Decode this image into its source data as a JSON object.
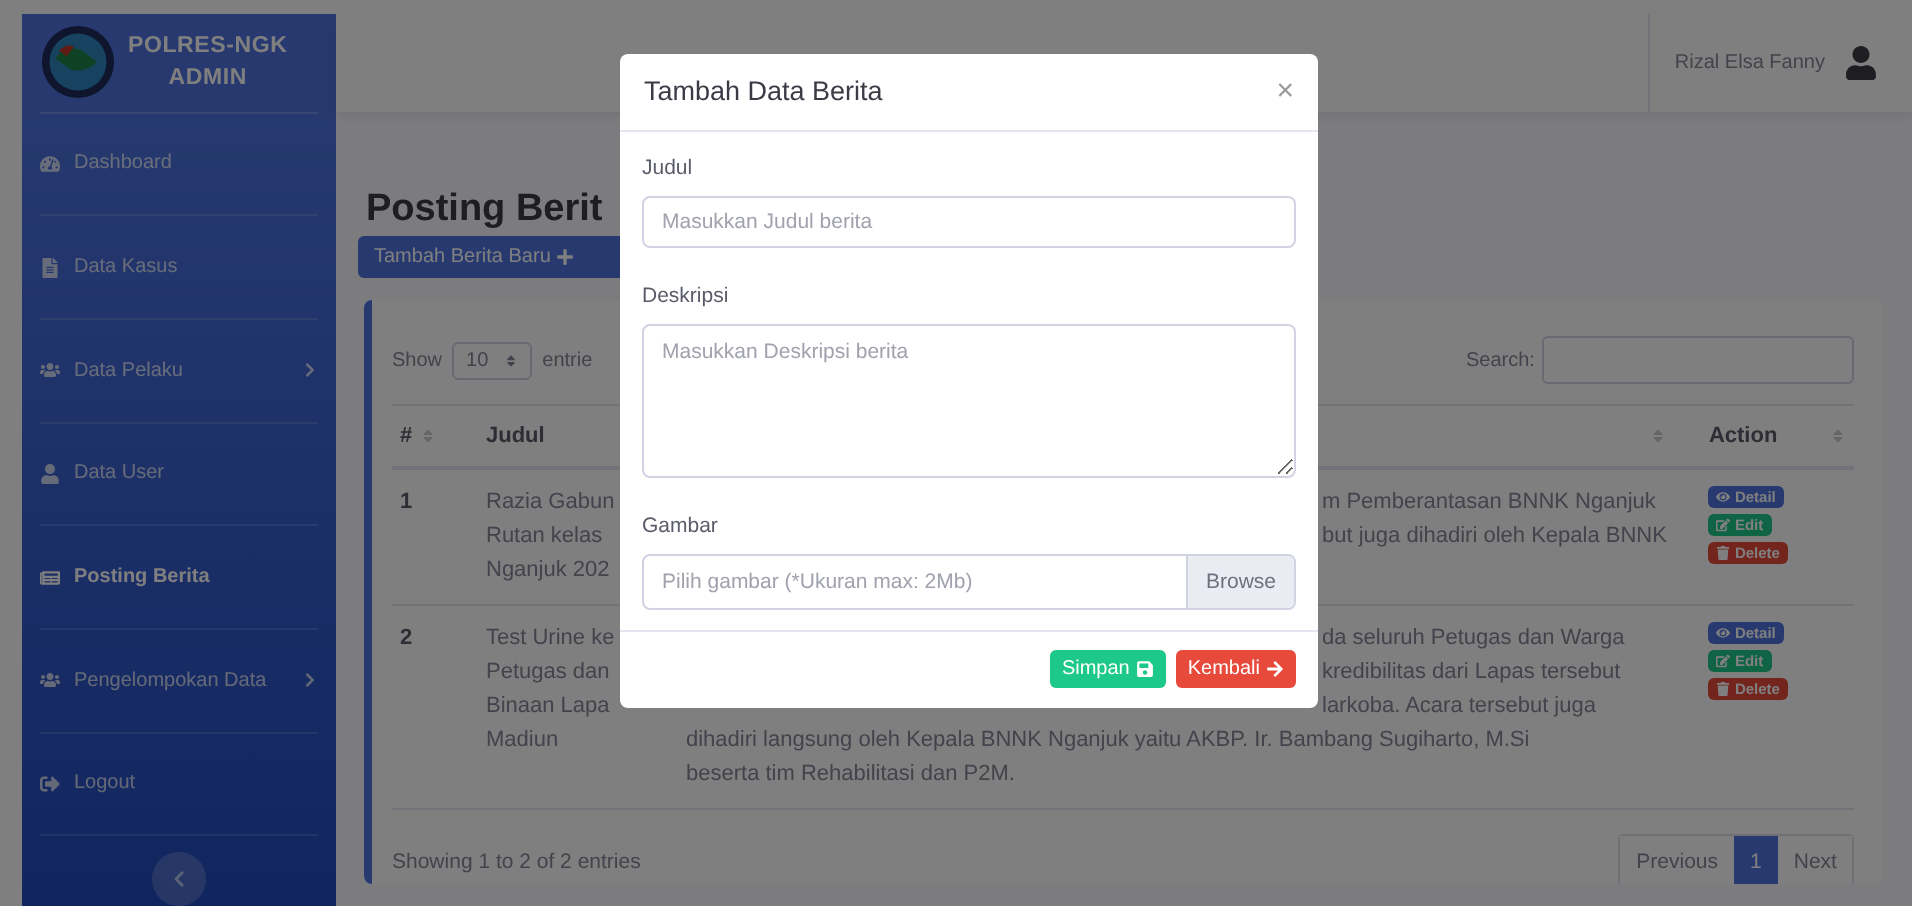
{
  "sidebar": {
    "brand_lines": [
      "POLRES-NGK",
      "ADMIN"
    ],
    "items": [
      {
        "label": "Dashboard",
        "kind": "dashboard",
        "selected": false,
        "has_submenu": false
      },
      {
        "label": "Data Kasus",
        "kind": "file",
        "selected": false,
        "has_submenu": false
      },
      {
        "label": "Data Pelaku",
        "kind": "users",
        "selected": false,
        "has_submenu": true
      },
      {
        "label": "Data User",
        "kind": "user",
        "selected": false,
        "has_submenu": false
      },
      {
        "label": "Posting Berita",
        "kind": "news",
        "selected": true,
        "has_submenu": false
      },
      {
        "label": "Pengelompokan Data",
        "kind": "users",
        "selected": false,
        "has_submenu": true
      },
      {
        "label": "Logout",
        "kind": "logout",
        "selected": false,
        "has_submenu": false
      }
    ]
  },
  "topbar": {
    "user_name": "Rizal Elsa Fanny"
  },
  "page": {
    "title": "Posting Berit",
    "add_button": "Tambah Berita Baru"
  },
  "table": {
    "show_label": "Show",
    "page_size": "10",
    "entries_label": "entrie",
    "search_label": "Search:",
    "columns": [
      "#",
      "Judul",
      "Action"
    ],
    "rows": [
      {
        "number": "1",
        "title_lines": [
          "Razia Gabun",
          "Rutan kelas",
          "Nganjuk 202"
        ],
        "description_lines": [
          {
            "text": "m Pemberantasan BNNK Nganjuk",
            "kind": "cut"
          },
          {
            "text": "but juga dihadiri oleh Kepala BNNK",
            "kind": "cut"
          }
        ],
        "actions": [
          {
            "label": "Detail",
            "kind": "detail"
          },
          {
            "label": "Edit",
            "kind": "edit"
          },
          {
            "label": "Delete",
            "kind": "delete"
          }
        ]
      },
      {
        "number": "2",
        "title_lines": [
          "Test Urine ke",
          "Petugas dan",
          "Binaan Lapa",
          "Madiun"
        ],
        "description_lines": [
          {
            "text": "da seluruh Petugas dan Warga",
            "kind": "cut"
          },
          {
            "text": "kredibilitas dari Lapas tersebut",
            "kind": "cut"
          },
          {
            "text": "larkoba. Acara tersebut juga",
            "kind": "cut"
          },
          {
            "text": "dihadiri langsung oleh Kepala BNNK Nganjuk yaitu AKBP. Ir. Bambang Sugiharto, M.Si",
            "kind": "full"
          },
          {
            "text": "beserta tim Rehabilitasi dan P2M.",
            "kind": "full"
          }
        ],
        "actions": [
          {
            "label": "Detail",
            "kind": "detail"
          },
          {
            "label": "Edit",
            "kind": "edit"
          },
          {
            "label": "Delete",
            "kind": "delete"
          }
        ]
      }
    ],
    "info": "Showing 1 to 2 of 2 entries",
    "pagination": [
      {
        "label": "Previous",
        "selected": false
      },
      {
        "label": "1",
        "selected": true
      },
      {
        "label": "Next",
        "selected": false
      }
    ]
  },
  "modal": {
    "title": "Tambah Data Berita",
    "close": "×",
    "fields": [
      {
        "label": "Judul",
        "kind": "text",
        "placeholder": "Masukkan Judul berita"
      },
      {
        "label": "Deskripsi",
        "kind": "textarea",
        "placeholder": "Masukkan Deskripsi berita"
      },
      {
        "label": "Gambar",
        "kind": "file",
        "placeholder": "Pilih gambar (*Ukuran max: 2Mb)",
        "button": "Browse"
      }
    ],
    "buttons": [
      {
        "label": "Simpan",
        "kind": "save"
      },
      {
        "label": "Kembali",
        "kind": "back"
      }
    ]
  }
}
